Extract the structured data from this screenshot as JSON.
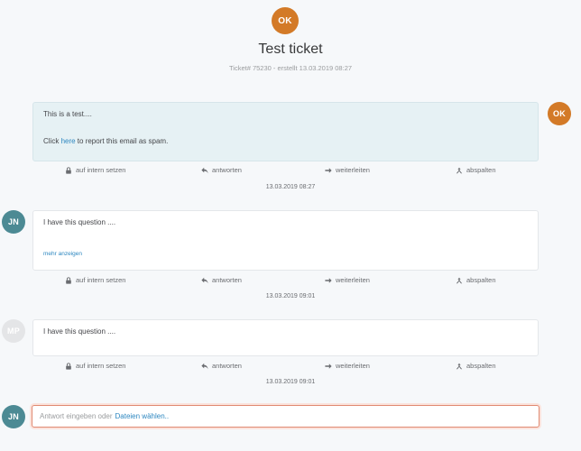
{
  "header": {
    "avatar_initials": "OK",
    "title": "Test ticket",
    "meta": "Ticket# 75230 - erstellt 13.03.2019 08:27"
  },
  "articles": [
    {
      "avatar": "OK",
      "avatar_color": "#d37a27",
      "side": "right",
      "internal": true,
      "body_line1": "This is a test....",
      "body_click_prefix": "Click ",
      "body_link": "here",
      "body_click_suffix": " to report this email as spam.",
      "timestamp": "13.03.2019 08:27"
    },
    {
      "avatar": "JN",
      "avatar_color": "#4c8a94",
      "side": "left",
      "internal": false,
      "body_line1": "I have this question ....",
      "more_link": "mehr anzeigen",
      "timestamp": "13.03.2019 09:01"
    },
    {
      "avatar": "MP",
      "avatar_color": "#e4e5e7",
      "side": "left",
      "internal": false,
      "body_line1": "I have this question ....",
      "timestamp": "13.03.2019 09:01"
    }
  ],
  "actions": {
    "internal": "auf intern setzen",
    "reply": "antworten",
    "forward": "weiterleiten",
    "split": "abspalten"
  },
  "reply": {
    "avatar": "JN",
    "placeholder": "Antwort eingeben oder",
    "files_link": "Dateien wählen.."
  },
  "colors": {
    "accent_link": "#2d87c0",
    "avatar_ok": "#d37a27",
    "avatar_jn": "#4c8a94",
    "internal_bg": "#e6f1f4",
    "reply_border": "#e08a72"
  }
}
